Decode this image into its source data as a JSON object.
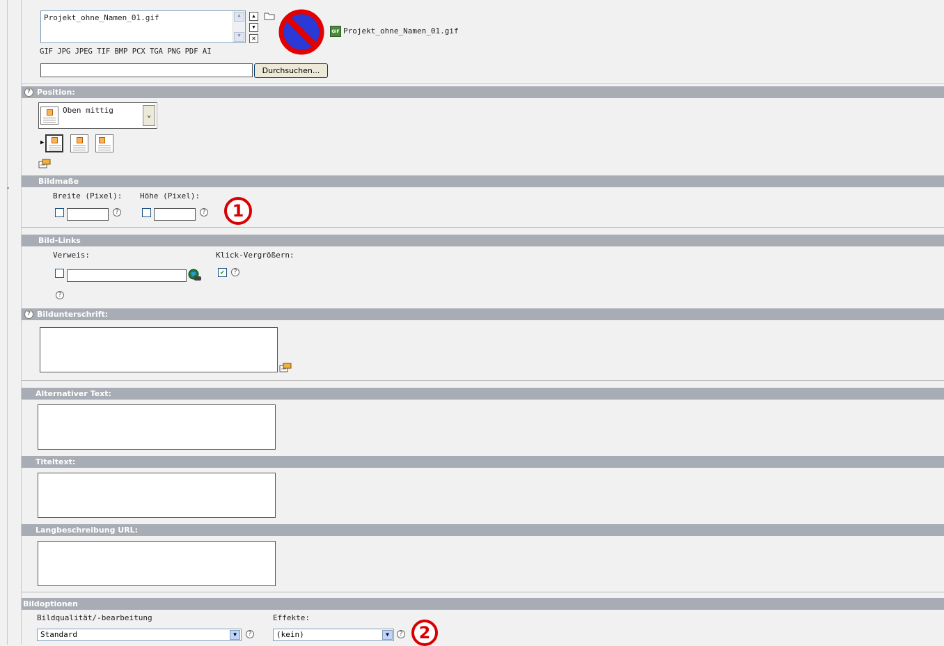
{
  "file": {
    "list_item": "Projekt_ohne_Namen_01.gif",
    "thumb_name": "Projekt_ohne_Namen_01.gif",
    "thumb_badge": "GIF",
    "allowed_types": "GIF JPG JPEG TIF BMP PCX TGA PNG PDF AI",
    "upload_value": "",
    "browse_label": "Durchsuchen..."
  },
  "position": {
    "header": "Position:",
    "selected": "Oben mittig"
  },
  "dimensions": {
    "header": "Bildmaße",
    "width_label": "Breite (Pixel):",
    "height_label": "Höhe (Pixel):",
    "width_value": "",
    "height_value": ""
  },
  "links": {
    "header": "Bild-Links",
    "link_label": "Verweis:",
    "link_value": "",
    "click_enlarge_label": "Klick-Vergrößern:",
    "click_enlarge_checked": true
  },
  "caption": {
    "header": "Bildunterschrift:",
    "value": ""
  },
  "alt_text": {
    "header": "Alternativer Text:",
    "value": ""
  },
  "title_text": {
    "header": "Titeltext:",
    "value": ""
  },
  "longdesc": {
    "header": "Langbeschreibung URL:",
    "value": ""
  },
  "options": {
    "header": "Bildoptionen",
    "quality_label": "Bildqualität/-bearbeitung",
    "quality_value": "Standard",
    "effects_label": "Effekte:",
    "effects_value": "(kein)"
  },
  "annotations": {
    "badge1": "1",
    "badge2": "2",
    "badge_color": "#d80000"
  },
  "colors": {
    "header_bg": "#a8acb4",
    "page_bg": "#f1f1f1"
  },
  "help_glyph": "?"
}
